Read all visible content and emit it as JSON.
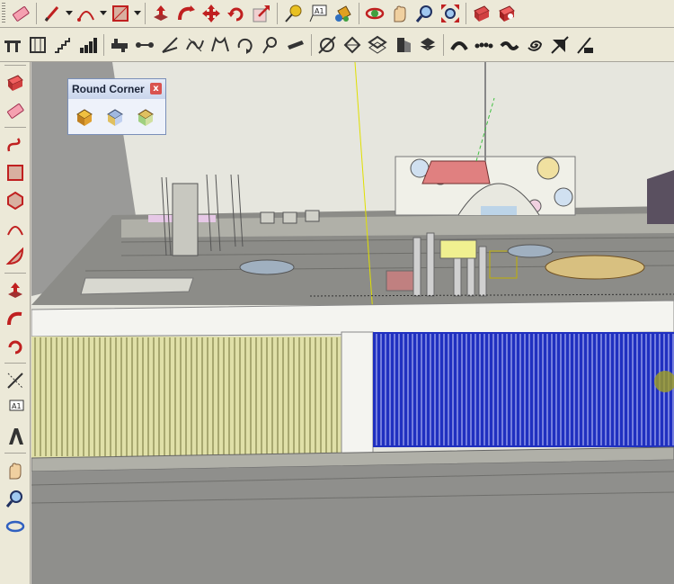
{
  "round_corner": {
    "title": "Round Corner",
    "close_glyph": "x"
  },
  "labels": {
    "text_tool": "A1",
    "text_tool_left": "A1"
  },
  "top_row_1": [
    "eraser-icon",
    "pencil-icon",
    "arc-icon",
    "rectangle-icon",
    "push-pull-icon",
    "follow-me-icon",
    "move-icon",
    "rotate-icon",
    "scale-icon",
    "tape-measure-icon",
    "text-icon",
    "paint-bucket-icon",
    "orbit-icon",
    "pan-icon",
    "zoom-icon",
    "zoom-extents-icon",
    "warehouse-icon",
    "extension-icon"
  ],
  "top_row_2": [
    "grip-icon",
    "grid-icon",
    "stairs-icon",
    "bar-icon",
    "bridge-icon",
    "join-icon",
    "vertex-icon",
    "bezier-icon",
    "curve-icon",
    "spin-icon",
    "tool-icon",
    "wall-icon",
    "node-icon",
    "faces-icon",
    "extrude-icon",
    "lathe-icon",
    "section-icon",
    "arch-icon",
    "dots-icon",
    "wave-icon",
    "spiral-icon",
    "cut-icon",
    "misc-icon"
  ],
  "left_tools": [
    "select-icon",
    "eraser-icon",
    "freehand-icon",
    "rectangle-icon",
    "polygon-icon",
    "arc-icon",
    "pie-icon",
    "push-pull-icon",
    "follow-me-icon",
    "offset-icon",
    "dimension-icon",
    "text-icon",
    "3d-text-icon",
    "pan-icon",
    "zoom-icon",
    "orbit-icon"
  ],
  "colors": {
    "sky": "#e8e8e0",
    "ground": "#8f8f8c",
    "selection": "#2030c0",
    "fence": "#e0e0a8"
  }
}
